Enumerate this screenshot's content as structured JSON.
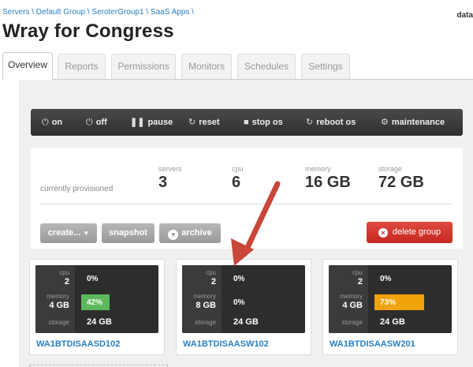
{
  "breadcrumb": [
    "Servers",
    "Default Group",
    "SeroterGroup1",
    "SaaS Apps"
  ],
  "header_right": "data",
  "page_title": "Wray for Congress",
  "tabs": [
    "Overview",
    "Reports",
    "Permissions",
    "Monitors",
    "Schedules",
    "Settings"
  ],
  "toolbar": {
    "on": "on",
    "off": "off",
    "pause": "pause",
    "reset": "reset",
    "stop_os": "stop os",
    "reboot_os": "reboot os",
    "maintenance": "maintenance"
  },
  "summary": {
    "provisioned_label": "currently provisioned",
    "servers_label": "servers",
    "servers_value": "3",
    "cpu_label": "cpu",
    "cpu_value": "6",
    "memory_label": "memory",
    "memory_value": "16 GB",
    "storage_label": "storage",
    "storage_value": "72 GB"
  },
  "actions": {
    "create": "create...",
    "snapshot": "snapshot",
    "archive": "archive",
    "delete_group": "delete group"
  },
  "servers": [
    {
      "name": "WA1BTDISAASD102",
      "cpu": "2",
      "memory": "4 GB",
      "storage": "24 GB",
      "cpu_pct": "0%",
      "mem_pct": "42%",
      "mem_pct_value": 42,
      "mem_color": "#5cb85c"
    },
    {
      "name": "WA1BTDISAASW102",
      "cpu": "2",
      "memory": "8 GB",
      "storage": "24 GB",
      "cpu_pct": "0%",
      "mem_pct": "0%",
      "mem_pct_value": 0,
      "mem_color": "#5cb85c"
    },
    {
      "name": "WA1BTDISAASW201",
      "cpu": "2",
      "memory": "4 GB",
      "storage": "24 GB",
      "cpu_pct": "0%",
      "mem_pct": "73%",
      "mem_pct_value": 73,
      "mem_color": "#f0a30a"
    }
  ],
  "card_labels": {
    "cpu": "cpu",
    "memory": "memory",
    "storage": "storage"
  },
  "colors": {
    "link": "#2a7fc1",
    "delete": "#d0312a",
    "annotation_arrow": "#c8463a"
  }
}
